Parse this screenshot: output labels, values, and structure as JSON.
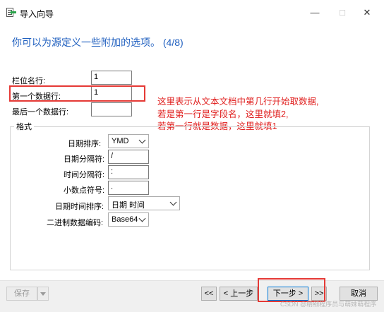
{
  "window": {
    "title": "导入向导",
    "minimize_glyph": "—",
    "maximize_glyph": "□",
    "close_glyph": "✕",
    "title_icon": "import-wizard-icon"
  },
  "heading": "你可以为源定义一些附加的选项。 (4/8)",
  "top_fields": {
    "field_name_row_label": "栏位名行:",
    "field_name_row_value": "1",
    "first_data_row_label": "第一个数据行:",
    "first_data_row_value": "1",
    "last_data_row_label": "最后一个数据行:",
    "last_data_row_value": ""
  },
  "format": {
    "legend": "格式",
    "date_order_label": "日期排序:",
    "date_order_value": "YMD",
    "date_separator_label": "日期分隔符:",
    "date_separator_value": "/",
    "time_separator_label": "时间分隔符:",
    "time_separator_value": ":",
    "decimal_symbol_label": "小数点符号:",
    "decimal_symbol_value": ".",
    "datetime_order_label": "日期时间排序:",
    "datetime_order_value": "日期 时间",
    "binary_encoding_label": "二进制数据编码:",
    "binary_encoding_value": "Base64"
  },
  "annotation": {
    "line1": "这里表示从文本文档中第几行开始取数据,",
    "line2": "若是第一行是字段名，这里就填2,",
    "line3": "若第一行就是数据，这里就填1",
    "color": "#e0201f"
  },
  "buttons": {
    "save": "保存",
    "first": "<<",
    "prev": "< 上一步",
    "next": "下一步 >",
    "last": ">>",
    "cancel": "取消"
  },
  "watermark": "CSDN @精细程序员与萌妹萌程序"
}
